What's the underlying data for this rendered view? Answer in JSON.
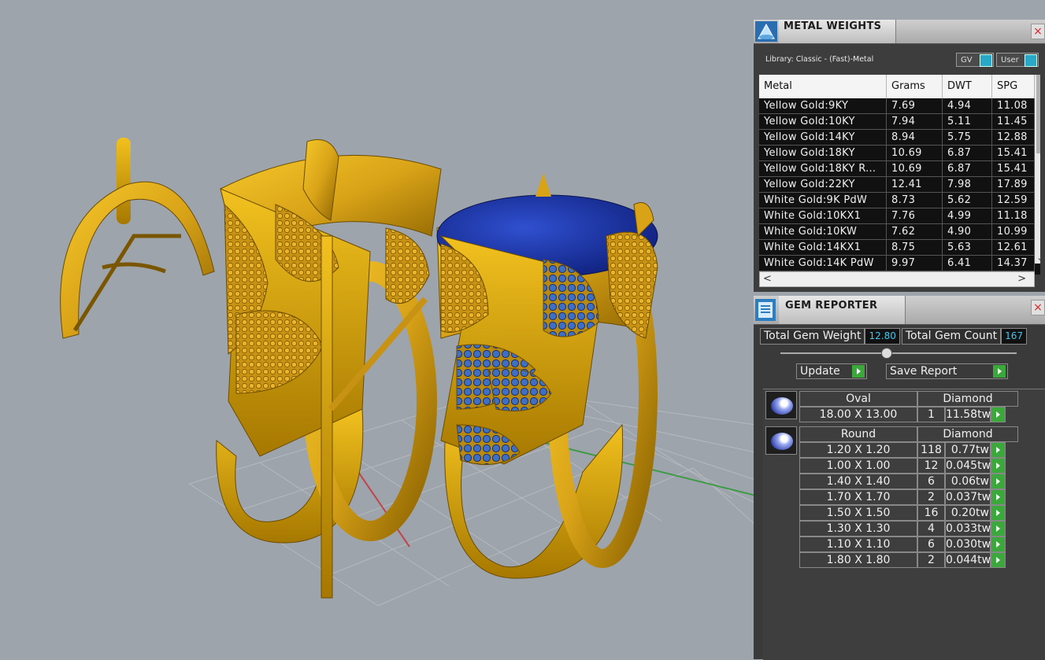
{
  "metal_weights": {
    "title": "METAL WEIGHTS",
    "close": "×",
    "library": "Library: Classic - (Fast)-Metal",
    "toggles": [
      "GV",
      "User"
    ],
    "columns": [
      "Metal",
      "Grams",
      "DWT",
      "SPG"
    ],
    "rows": [
      [
        "Yellow Gold:9KY",
        "7.69",
        "4.94",
        "11.08"
      ],
      [
        "Yellow Gold:10KY",
        "7.94",
        "5.11",
        "11.45"
      ],
      [
        "Yellow Gold:14KY",
        "8.94",
        "5.75",
        "12.88"
      ],
      [
        "Yellow Gold:18KY",
        "10.69",
        "6.87",
        "15.41"
      ],
      [
        "Yellow Gold:18KY R...",
        "10.69",
        "6.87",
        "15.41"
      ],
      [
        "Yellow Gold:22KY",
        "12.41",
        "7.98",
        "17.89"
      ],
      [
        "White Gold:9K PdW",
        "8.73",
        "5.62",
        "12.59"
      ],
      [
        "White Gold:10KX1",
        "7.76",
        "4.99",
        "11.18"
      ],
      [
        "White Gold:10KW",
        "7.62",
        "4.90",
        "10.99"
      ],
      [
        "White Gold:14KX1",
        "8.75",
        "5.63",
        "12.61"
      ],
      [
        "White Gold:14K PdW",
        "9.97",
        "6.41",
        "14.37"
      ]
    ],
    "scroll_down": "⌄",
    "scroll_left": "<",
    "scroll_right": ">"
  },
  "gem_reporter": {
    "title": "GEM REPORTER",
    "close": "×",
    "total_weight_label": "Total Gem Weight",
    "total_weight": "12.80",
    "total_count_label": "Total Gem Count",
    "total_count": "167",
    "update_label": "Update",
    "save_label": "Save Report",
    "groups": [
      {
        "shape": "Oval",
        "type": "Diamond",
        "rows": [
          [
            "18.00 X 13.00",
            "1",
            "11.58tw"
          ]
        ]
      },
      {
        "shape": "Round",
        "type": "Diamond",
        "rows": [
          [
            "1.20 X 1.20",
            "118",
            "0.77tw"
          ],
          [
            "1.00 X 1.00",
            "12",
            "0.045tw"
          ],
          [
            "1.40 X 1.40",
            "6",
            "0.06tw"
          ],
          [
            "1.70 X 1.70",
            "2",
            "0.037tw"
          ],
          [
            "1.50 X 1.50",
            "16",
            "0.20tw"
          ],
          [
            "1.30 X 1.30",
            "4",
            "0.033tw"
          ],
          [
            "1.10 X 1.10",
            "6",
            "0.030tw"
          ],
          [
            "1.80 X 1.80",
            "2",
            "0.044tw"
          ]
        ]
      }
    ]
  },
  "colors": {
    "viewport_bg": "#9ea4ab",
    "gold": "#d9a318",
    "gold_dark": "#8a6200",
    "sapphire": "#1e3aa8",
    "accent_cyan": "#3fc8ee",
    "go_green": "#3aa83a"
  }
}
